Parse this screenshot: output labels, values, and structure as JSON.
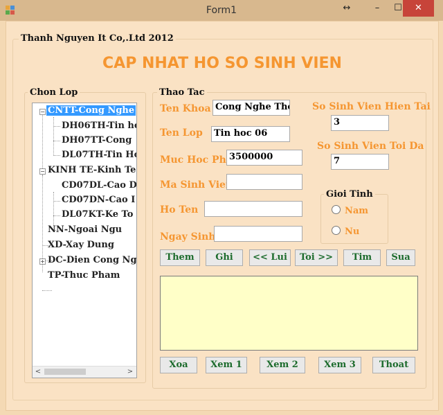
{
  "window": {
    "title": "Form1",
    "resize_glyph": "↔",
    "minimize_glyph": "–",
    "maximize_glyph": "☐",
    "close_glyph": "✕"
  },
  "form": {
    "company": "Thanh Nguyen It Co,.Ltd 2012",
    "heading": "CAP NHAT HO SO SINH VIEN"
  },
  "chon_lop": {
    "title": "Chon Lop",
    "nodes": [
      {
        "label": "CNTT-Cong Nghe",
        "expander": "−"
      },
      {
        "label": "DH06TH-Tin ho"
      },
      {
        "label": "DH07TT-Cong"
      },
      {
        "label": "DL07TH-Tin Ho"
      },
      {
        "label": "KINH TE-Kinh Te",
        "expander": "−"
      },
      {
        "label": "CD07DL-Cao D"
      },
      {
        "label": "CD07DN-Cao I"
      },
      {
        "label": "DL07KT-Ke To"
      },
      {
        "label": "NN-Ngoai Ngu"
      },
      {
        "label": "XD-Xay Dung"
      },
      {
        "label": "DC-Dien Cong Ng",
        "expander": "+"
      },
      {
        "label": "TP-Thuc Pham"
      }
    ],
    "scroll_left": "<",
    "scroll_right": ">"
  },
  "thao_tac": {
    "title": "Thao Tac",
    "ten_khoa_label": "Ten Khoa",
    "ten_khoa_value": "Cong Nghe Thoi",
    "ten_lop_label": "Ten Lop",
    "ten_lop_value": "Tin hoc 06",
    "muc_hoc_phi_label": "Muc Hoc Phi",
    "muc_hoc_phi_value": "3500000",
    "ma_sinh_vien_label": "Ma Sinh Vien",
    "ma_sinh_vien_value": "",
    "ho_ten_label": "Ho Ten",
    "ho_ten_value": "",
    "ngay_sinh_label": "Ngay Sinh",
    "ngay_sinh_value": "",
    "ss_hien_tai_label": "So Sinh Vien Hien Tai",
    "ss_hien_tai_value": "3",
    "ss_toi_da_label": "So Sinh Vien Toi Da",
    "ss_toi_da_value": "7",
    "gioi_tinh": {
      "title": "Gioi Tinh",
      "nam": "Nam",
      "nu": "Nu"
    },
    "buttons_top": {
      "them": "Them",
      "ghi": "Ghi",
      "lui": "<< Lui",
      "toi": "Toi >>",
      "tim": "Tim",
      "sua": "Sua"
    },
    "memo_text": "",
    "buttons_bottom": {
      "xoa": "Xoa",
      "xem1": "Xem 1",
      "xem2": "Xem 2",
      "xem3": "Xem 3",
      "thoat": "Thoat"
    }
  },
  "colors": {
    "titlebar": "#d8b88e",
    "form_bg": "#fae2c4",
    "label_orange": "#f59631",
    "button_text": "#1c6b2c",
    "selection": "#3399ff",
    "memo_bg": "#ffffc8",
    "close_button": "#c7443a"
  }
}
